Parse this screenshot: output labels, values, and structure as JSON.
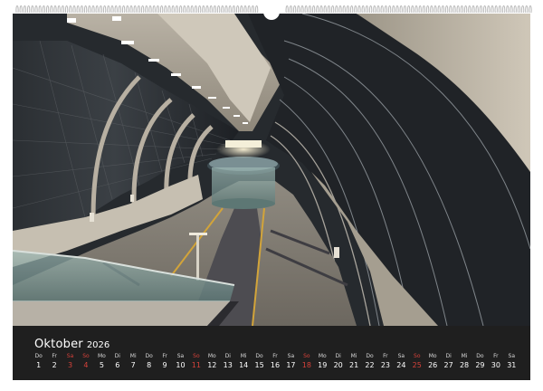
{
  "calendar": {
    "month": "Oktober",
    "year": "2026",
    "days": [
      {
        "wd": "Do",
        "d": "1"
      },
      {
        "wd": "Fr",
        "d": "2"
      },
      {
        "wd": "Sa",
        "d": "3",
        "hol": true
      },
      {
        "wd": "So",
        "d": "4",
        "sun": true
      },
      {
        "wd": "Mo",
        "d": "5"
      },
      {
        "wd": "Di",
        "d": "6"
      },
      {
        "wd": "Mi",
        "d": "7"
      },
      {
        "wd": "Do",
        "d": "8"
      },
      {
        "wd": "Fr",
        "d": "9"
      },
      {
        "wd": "Sa",
        "d": "10"
      },
      {
        "wd": "So",
        "d": "11",
        "sun": true
      },
      {
        "wd": "Mo",
        "d": "12"
      },
      {
        "wd": "Di",
        "d": "13"
      },
      {
        "wd": "Mi",
        "d": "14"
      },
      {
        "wd": "Do",
        "d": "15"
      },
      {
        "wd": "Fr",
        "d": "16"
      },
      {
        "wd": "Sa",
        "d": "17"
      },
      {
        "wd": "So",
        "d": "18",
        "sun": true
      },
      {
        "wd": "Mo",
        "d": "19"
      },
      {
        "wd": "Di",
        "d": "20"
      },
      {
        "wd": "Mi",
        "d": "21"
      },
      {
        "wd": "Do",
        "d": "22"
      },
      {
        "wd": "Fr",
        "d": "23"
      },
      {
        "wd": "Sa",
        "d": "24"
      },
      {
        "wd": "So",
        "d": "25",
        "sun": true
      },
      {
        "wd": "Mo",
        "d": "26"
      },
      {
        "wd": "Di",
        "d": "27"
      },
      {
        "wd": "Mi",
        "d": "28"
      },
      {
        "wd": "Do",
        "d": "29"
      },
      {
        "wd": "Fr",
        "d": "30"
      },
      {
        "wd": "Sa",
        "d": "31"
      }
    ]
  },
  "colors": {
    "sheet": "#1e1e1e",
    "holiday": "#d6423a",
    "text": "#ffffff"
  }
}
